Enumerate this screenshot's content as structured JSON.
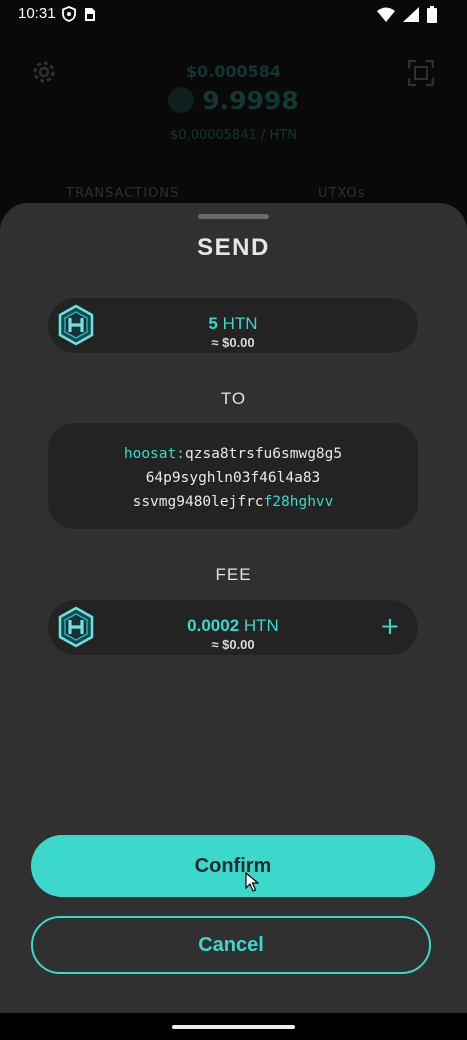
{
  "status_bar": {
    "time": "10:31",
    "left_icons": [
      "shield-icon",
      "sim-card-icon"
    ],
    "right_icons": [
      "wifi-icon",
      "signal-icon",
      "battery-icon"
    ]
  },
  "background": {
    "balance_fiat": "$0.000584",
    "balance": "9.9998",
    "price": "$0.00005841 / HTN",
    "tabs": [
      "TRANSACTIONS",
      "UTXOs"
    ]
  },
  "send_sheet": {
    "title": "SEND",
    "amount": {
      "value": "5",
      "unit": "HTN",
      "fiat": "≈ $0.00"
    },
    "to_label": "TO",
    "address": {
      "prefix": "hoosat",
      "separator": ":",
      "line1_rest": "qzsa8trsfu6smwg8g5",
      "line2": "64p9syghln03f46l4a83",
      "line3_plain": "ssvmg9480lejfrc",
      "line3_accent": "f28hghvv"
    },
    "fee_label": "FEE",
    "fee": {
      "value": "0.0002",
      "unit": "HTN",
      "fiat": "≈ $0.00",
      "add_symbol": "+"
    },
    "confirm_label": "Confirm",
    "cancel_label": "Cancel"
  },
  "colors": {
    "accent": "#3cd8cb",
    "sheet_bg": "#303030",
    "field_bg": "#232323",
    "app_bg": "#090909"
  }
}
